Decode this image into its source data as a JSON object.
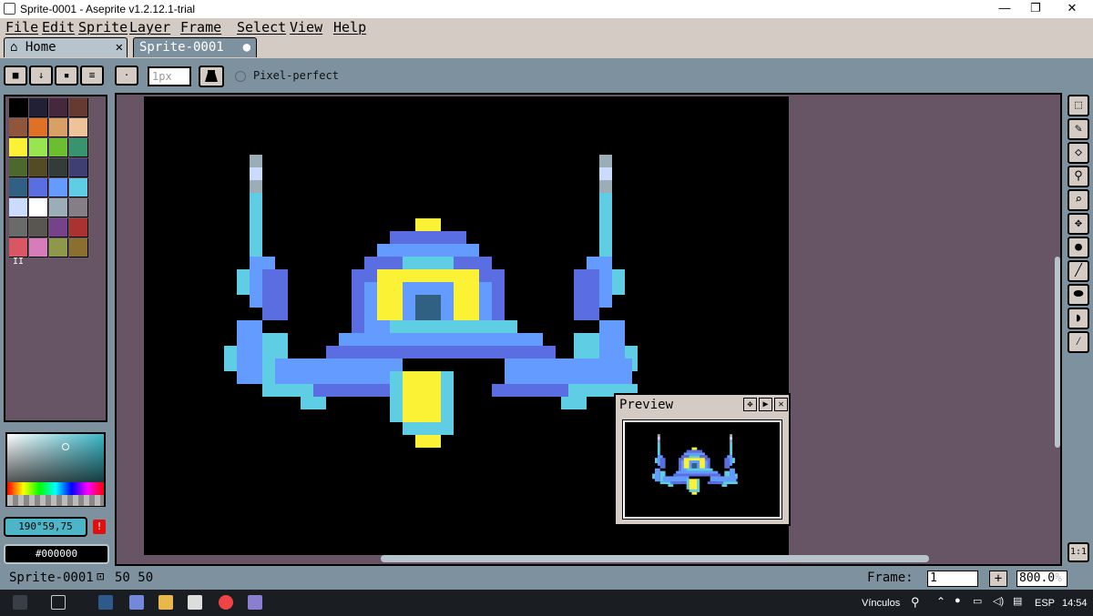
{
  "window": {
    "title": "Sprite-0001 - Aseprite v1.2.12.1-trial",
    "minimize": "—",
    "maximize": "❐",
    "close": "✕"
  },
  "menu": [
    "File",
    "Edit",
    "Sprite",
    "Layer",
    "Frame",
    "Select",
    "View",
    "Help"
  ],
  "tabs": [
    {
      "label": "Home",
      "close": "✕",
      "icon": "home-icon"
    },
    {
      "label": "Sprite-0001",
      "modified": "●"
    }
  ],
  "toolbar": {
    "brush_size": "1px",
    "pixel_perfect_label": "Pixel-perfect"
  },
  "palette": {
    "colors": [
      "#000000",
      "#222034",
      "#45283c",
      "#663931",
      "#8f563b",
      "#df7126",
      "#d9a066",
      "#eec39a",
      "#fbf236",
      "#99e550",
      "#6abe30",
      "#37946e",
      "#4b692f",
      "#524b24",
      "#323c39",
      "#3f3f74",
      "#306082",
      "#5b6ee1",
      "#639bff",
      "#5fcde4",
      "#cbdbfc",
      "#ffffff",
      "#9badb7",
      "#847e87",
      "#696a6a",
      "#595652",
      "#76428a",
      "#ac3232",
      "#d95763",
      "#d77bba",
      "#8f974a",
      "#8a6f30"
    ],
    "menu_glyph": "II"
  },
  "colors": {
    "fg_label": "190°59,75",
    "bg_label": "#000000",
    "accent": "#4cb6c8",
    "warn": "!"
  },
  "preview": {
    "title": "Preview",
    "btn_center": "✥",
    "btn_play": "▶",
    "btn_close": "✕"
  },
  "tools": [
    "marquee-icon",
    "pencil-icon",
    "eraser-icon",
    "eyedropper-icon",
    "zoom-icon",
    "move-icon",
    "fill-icon",
    "line-icon",
    "ellipse-icon",
    "contour-icon",
    "blur-icon"
  ],
  "tool_glyphs": [
    "⬚",
    "✎",
    "◇",
    "⚲",
    "⌕",
    "✥",
    "●",
    "╱",
    "⬬",
    "◗",
    "⁄"
  ],
  "status": {
    "sprite_name": "Sprite-0001",
    "size": "50 50",
    "frame_label": "Frame:",
    "frame_value": "1",
    "frame_add": "+",
    "zoom": "800.0",
    "zoom_unit": "%",
    "one_to_one": "1:1"
  },
  "taskbar": {
    "links_label": "Vínculos",
    "lang": "ESP",
    "time": "14:54"
  }
}
